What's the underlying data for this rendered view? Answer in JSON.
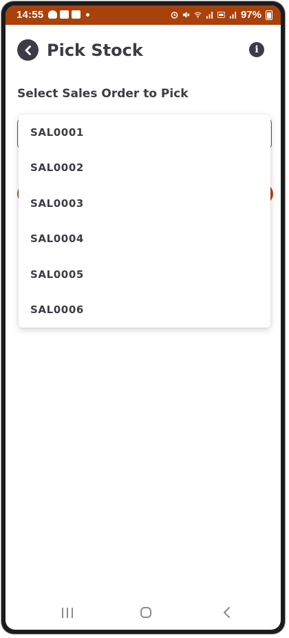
{
  "status_bar": {
    "time": "14:55",
    "battery": "97%",
    "icons": [
      "shopping-bag-icon",
      "youtube-icon",
      "mail-icon",
      "dot-icon",
      "alarm-icon",
      "mute-icon",
      "wifi-icon",
      "signal-icon",
      "volte-icon",
      "signal-icon",
      "battery-icon"
    ],
    "background": "#a8410b"
  },
  "header": {
    "title": "Pick Stock",
    "back_icon": "back-arrow-icon",
    "info_icon": "info-icon",
    "info_glyph": "i"
  },
  "form": {
    "label": "Select Sales Order to Pick",
    "accent_color": "#b8470f"
  },
  "dropdown": {
    "options": [
      "SAL0001",
      "SAL0002",
      "SAL0003",
      "SAL0004",
      "SAL0005",
      "SAL0006"
    ]
  },
  "navigation": {
    "recent_icon": "recent-apps-icon",
    "home_icon": "home-icon",
    "back_icon": "nav-back-icon"
  }
}
